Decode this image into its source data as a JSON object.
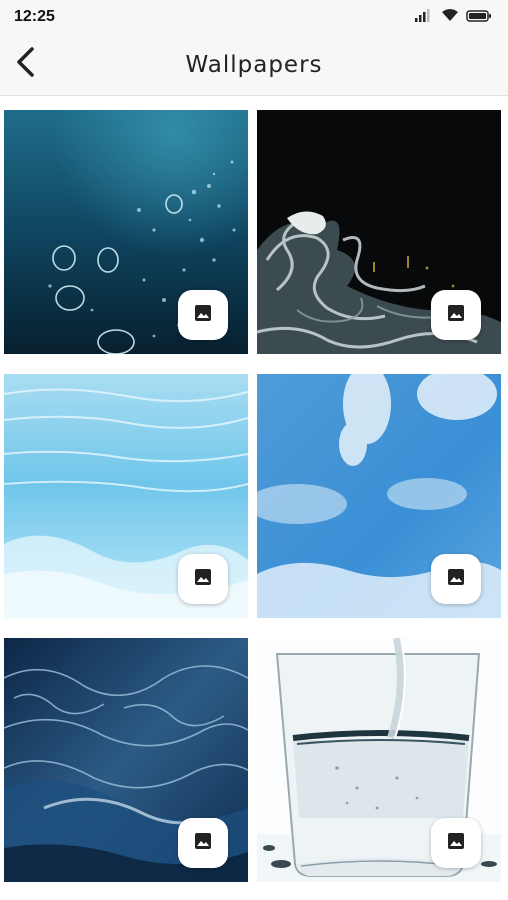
{
  "status_bar": {
    "time": "12:25",
    "icons": [
      "signal-icon",
      "wifi-icon",
      "battery-icon"
    ]
  },
  "app_bar": {
    "title": "Wallpapers",
    "back_icon": "chevron-left-icon"
  },
  "wallpapers": [
    {
      "id": 1,
      "subject": "underwater bubbles",
      "badge_icon": "image-icon"
    },
    {
      "id": 2,
      "subject": "dark swirling liquid",
      "badge_icon": "image-icon"
    },
    {
      "id": 3,
      "subject": "light blue water surface",
      "badge_icon": "image-icon"
    },
    {
      "id": 4,
      "subject": "blue sky clouds",
      "badge_icon": "image-icon"
    },
    {
      "id": 5,
      "subject": "deep blue waves",
      "badge_icon": "image-icon"
    },
    {
      "id": 6,
      "subject": "water pouring into glass",
      "badge_icon": "image-icon"
    }
  ],
  "colors": {
    "app_bar_bg": "#f7f7f7",
    "badge_bg": "#ffffff",
    "icon": "#222222"
  }
}
